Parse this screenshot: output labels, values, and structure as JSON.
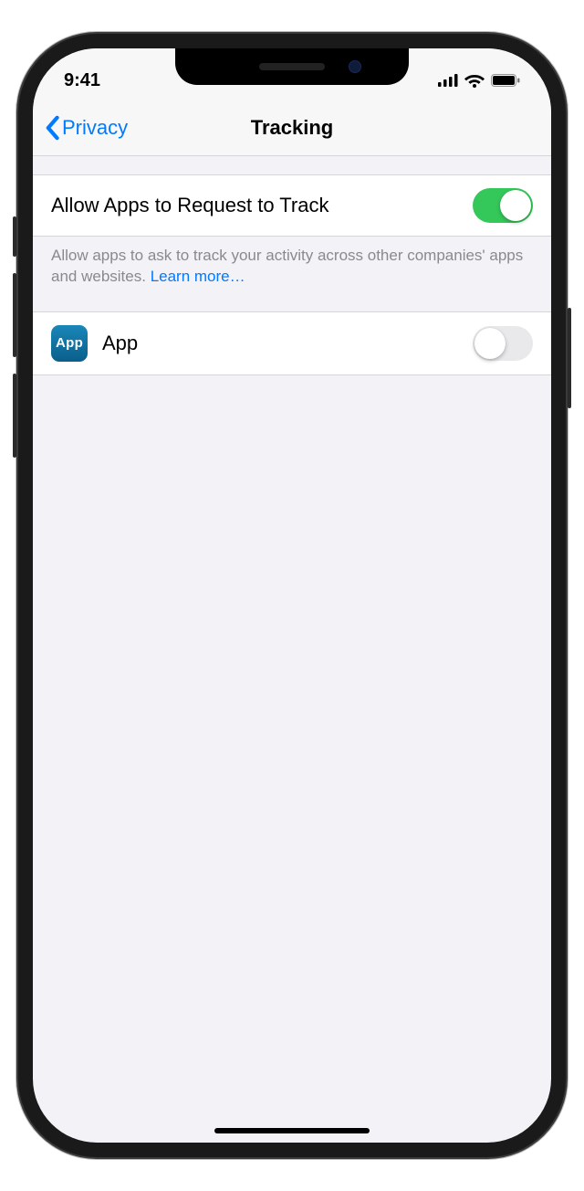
{
  "status": {
    "time": "9:41"
  },
  "nav": {
    "back_label": "Privacy",
    "title": "Tracking"
  },
  "allow": {
    "label": "Allow Apps to Request to Track",
    "on": true,
    "footer": "Allow apps to ask to track your activity across other companies' apps and websites. ",
    "learn_more": "Learn more…"
  },
  "apps": [
    {
      "icon_text": "App",
      "name": "App",
      "on": false
    }
  ]
}
